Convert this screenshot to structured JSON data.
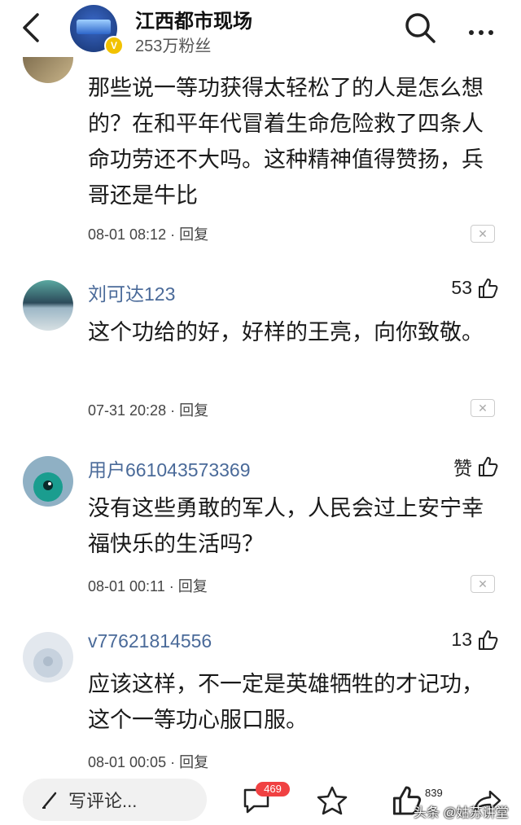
{
  "header": {
    "account_name": "江西都市现场",
    "followers": "253万粉丝",
    "verified_mark": "V"
  },
  "comments": [
    {
      "name": "",
      "text": "那些说一等功获得太轻松了的人是怎么想的？在和平年代冒着生命危险救了四条人命功劳还不大吗。这种精神值得赞扬，兵哥还是牛比",
      "time": "08-01 08:12",
      "reply": "回复",
      "likes": ""
    },
    {
      "name": "刘可达123",
      "text": "这个功给的好，好样的王亮，向你致敬。",
      "time": "07-31 20:28",
      "reply": "回复",
      "likes": "53"
    },
    {
      "name": "用户661043573369",
      "text": "没有这些勇敢的军人，人民会过上安宁幸福快乐的生活吗？",
      "time": "08-01 00:11",
      "reply": "回复",
      "likes": "赞"
    },
    {
      "name": "v77621814556",
      "text": "应该这样，不一定是英雄牺牲的才记功，这个一等功心服口服。",
      "time": "08-01 00:05",
      "reply": "回复",
      "likes": "13"
    }
  ],
  "meta_separator": " · ",
  "bottom": {
    "write_label": "写评论...",
    "comment_count": "469",
    "like_count": "839",
    "watermark": "头条 @姑苏讲堂"
  },
  "icons": {
    "back": "chevron-left-icon",
    "search": "search-icon",
    "more": "more-icon",
    "like": "thumb-up-icon",
    "close": "close-icon",
    "pencil": "pencil-icon",
    "comment": "comment-icon",
    "star": "star-icon",
    "share": "share-icon"
  },
  "colors": {
    "username": "#4a6a99",
    "badge": "#f04142",
    "verified": "#f2c200"
  }
}
